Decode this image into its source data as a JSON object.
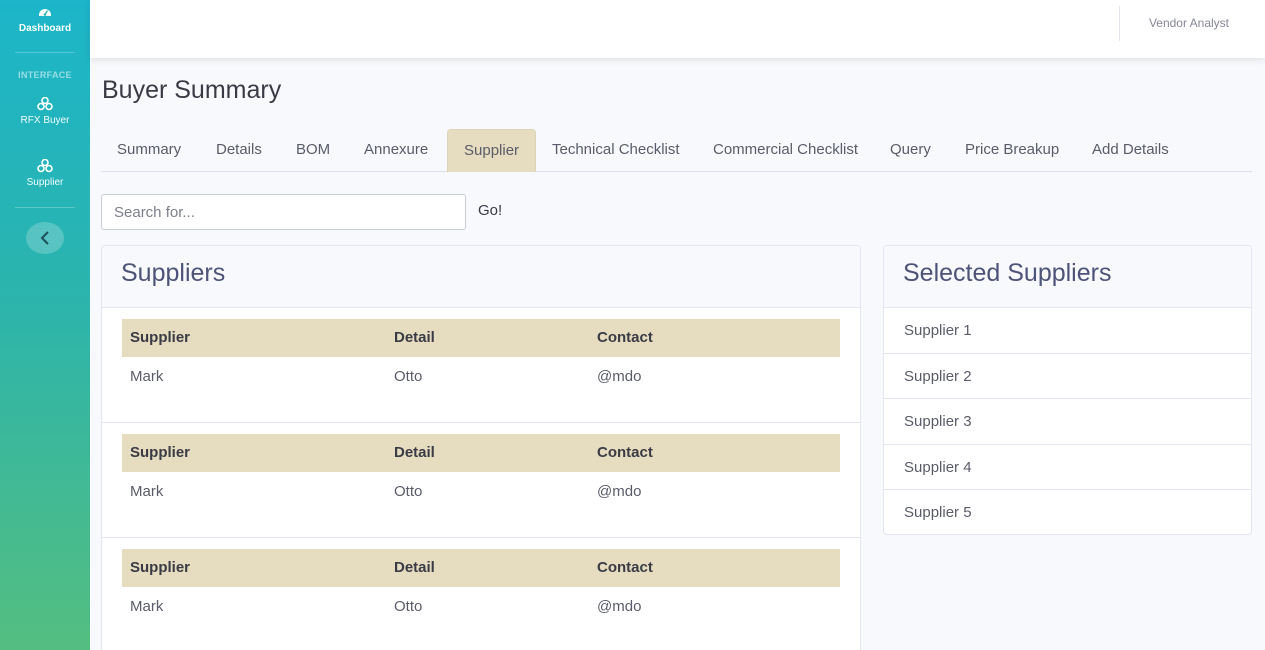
{
  "sidebar": {
    "dashboard": {
      "label": "Dashboard"
    },
    "heading": "INTERFACE",
    "items": [
      {
        "label": "RFX Buyer"
      },
      {
        "label": "Supplier"
      }
    ]
  },
  "topbar": {
    "user": "Vendor Analyst"
  },
  "page": {
    "title": "Buyer Summary"
  },
  "tabs": [
    {
      "label": "Summary"
    },
    {
      "label": "Details"
    },
    {
      "label": "BOM"
    },
    {
      "label": "Annexure"
    },
    {
      "label": "Supplier",
      "active": true
    },
    {
      "label": "Technical Checklist"
    },
    {
      "label": "Commercial Checklist"
    },
    {
      "label": "Query"
    },
    {
      "label": "Price Breakup"
    },
    {
      "label": "Add Details"
    }
  ],
  "search": {
    "placeholder": "Search for...",
    "value": "",
    "go_label": "Go!"
  },
  "suppliers": {
    "title": "Suppliers",
    "headers": [
      "Supplier",
      "Detail",
      "Contact"
    ],
    "tables": [
      {
        "supplier": "Mark",
        "detail": "Otto",
        "contact": "@mdo"
      },
      {
        "supplier": "Mark",
        "detail": "Otto",
        "contact": "@mdo"
      },
      {
        "supplier": "Mark",
        "detail": "Otto",
        "contact": "@mdo"
      }
    ]
  },
  "selected": {
    "title": "Selected Suppliers",
    "items": [
      "Supplier 1",
      "Supplier 2",
      "Supplier 3",
      "Supplier 4",
      "Supplier 5"
    ]
  },
  "colors": {
    "accent_tab": "#e6dcc0",
    "sidebar_top": "#1cb5c9",
    "sidebar_bottom": "#54be80",
    "header_text": "#4e5378"
  }
}
